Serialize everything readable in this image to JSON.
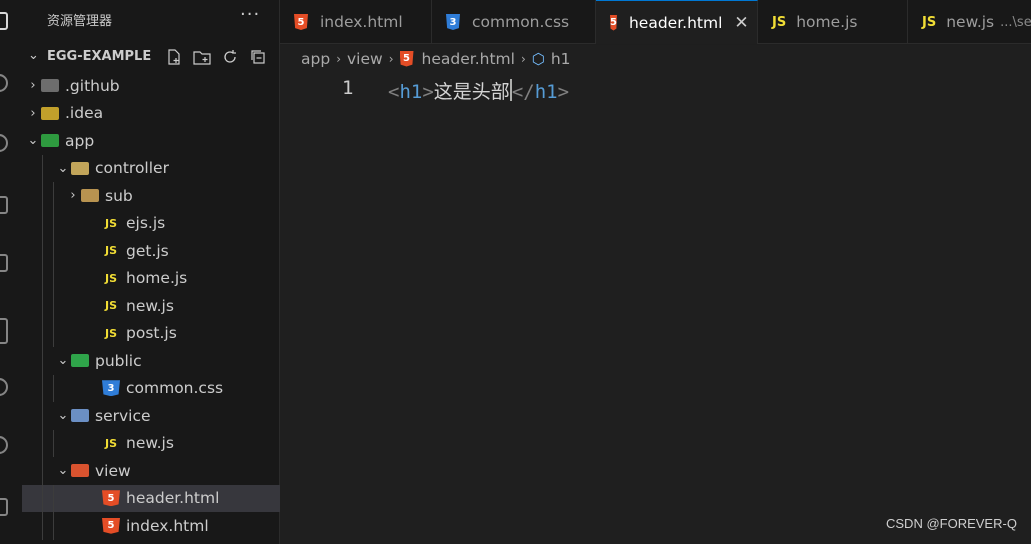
{
  "sidebar": {
    "title": "资源管理器",
    "more": "···",
    "project": "EGG-EXAMPLE",
    "tree": [
      {
        "label": ".github",
        "depth": 0,
        "chev": "›",
        "icon": "github-folder-icon",
        "color": "#6d6d6d"
      },
      {
        "label": ".idea",
        "depth": 0,
        "chev": "›",
        "icon": "idea-folder-icon",
        "color": "#c2a02b"
      },
      {
        "label": "app",
        "depth": 0,
        "chev": "⌄",
        "icon": "app-folder-icon",
        "color": "#2e9a3f"
      },
      {
        "label": "controller",
        "depth": 1,
        "chev": "⌄",
        "icon": "controller-folder-icon",
        "color": "#c2a55a"
      },
      {
        "label": "sub",
        "depth": 2,
        "chev": "›",
        "icon": "folder-icon",
        "color": "#b89350"
      },
      {
        "label": "ejs.js",
        "depth": 3,
        "chev": "",
        "icon": "js-icon"
      },
      {
        "label": "get.js",
        "depth": 3,
        "chev": "",
        "icon": "js-icon"
      },
      {
        "label": "home.js",
        "depth": 3,
        "chev": "",
        "icon": "js-icon"
      },
      {
        "label": "new.js",
        "depth": 3,
        "chev": "",
        "icon": "js-icon"
      },
      {
        "label": "post.js",
        "depth": 3,
        "chev": "",
        "icon": "js-icon"
      },
      {
        "label": "public",
        "depth": 1,
        "chev": "⌄",
        "icon": "public-folder-icon",
        "color": "#2fa44a"
      },
      {
        "label": "common.css",
        "depth": 3,
        "chev": "",
        "icon": "css-icon"
      },
      {
        "label": "service",
        "depth": 1,
        "chev": "⌄",
        "icon": "service-folder-icon",
        "color": "#6b8fc4"
      },
      {
        "label": "new.js",
        "depth": 3,
        "chev": "",
        "icon": "js-icon"
      },
      {
        "label": "view",
        "depth": 1,
        "chev": "⌄",
        "icon": "view-folder-icon",
        "color": "#d9532f"
      },
      {
        "label": "header.html",
        "depth": 3,
        "chev": "",
        "icon": "html-icon",
        "selected": true
      },
      {
        "label": "index.html",
        "depth": 3,
        "chev": "",
        "icon": "html-icon"
      }
    ]
  },
  "tabs": [
    {
      "label": "index.html",
      "icon": "html-icon"
    },
    {
      "label": "common.css",
      "icon": "css-icon"
    },
    {
      "label": "header.html",
      "icon": "html-icon",
      "active": true,
      "close": "✕"
    },
    {
      "label": "home.js",
      "icon": "js-icon"
    },
    {
      "label": "new.js",
      "icon": "js-icon",
      "desc": "...\\ser"
    }
  ],
  "breadcrumb": {
    "items": [
      "app",
      "view",
      "header.html",
      "h1"
    ]
  },
  "editor": {
    "line_number": "1",
    "open_lt": "<",
    "open_tag": "h1",
    "open_gt": ">",
    "text": "这是头部",
    "close_lt": "</",
    "close_tag": "h1",
    "close_gt": ">"
  },
  "watermark": "CSDN @FOREVER-Q",
  "icons": {
    "js": "JS",
    "html": "5",
    "css": "3"
  }
}
